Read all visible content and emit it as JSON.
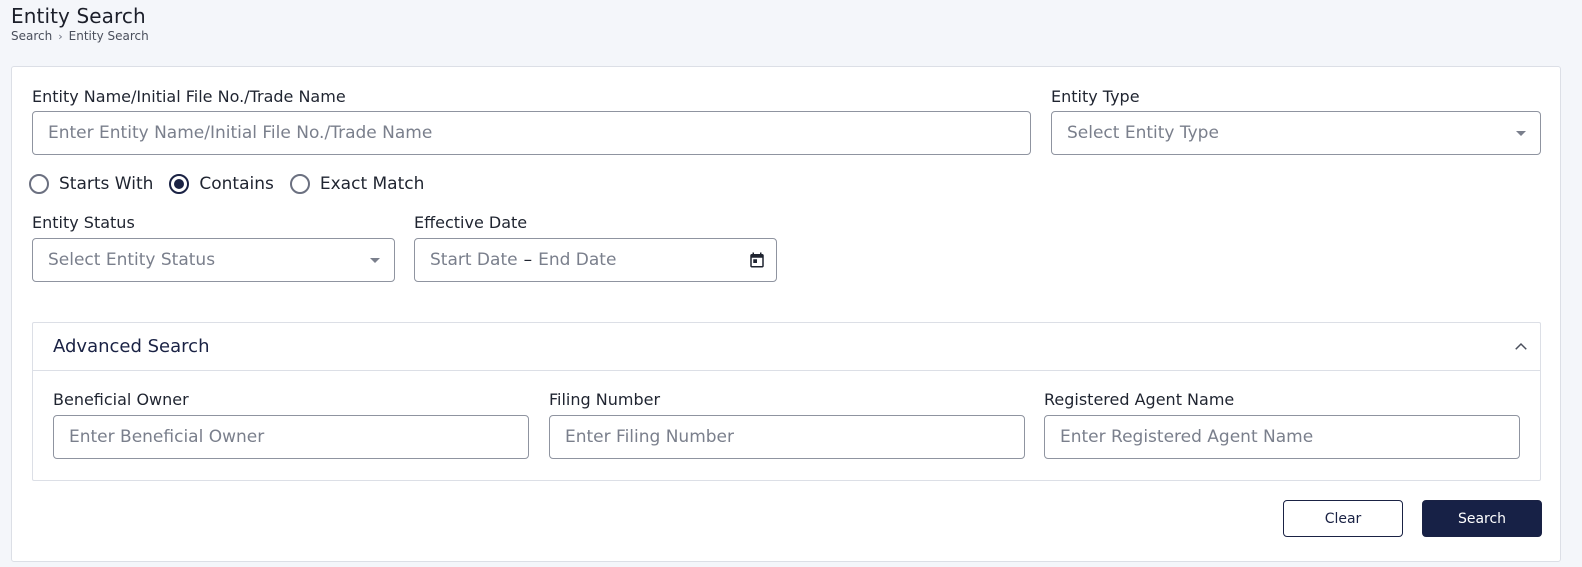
{
  "header": {
    "title": "Entity Search",
    "breadcrumb": [
      "Search",
      "Entity Search"
    ]
  },
  "form": {
    "entity_name": {
      "label": "Entity Name/Initial File No./Trade Name",
      "placeholder": "Enter Entity Name/Initial File No./Trade Name",
      "value": ""
    },
    "entity_type": {
      "label": "Entity Type",
      "placeholder": "Select Entity Type"
    },
    "match_options": [
      {
        "label": "Starts With",
        "checked": false
      },
      {
        "label": "Contains",
        "checked": true
      },
      {
        "label": "Exact Match",
        "checked": false
      }
    ],
    "entity_status": {
      "label": "Entity Status",
      "placeholder": "Select Entity Status"
    },
    "effective_date": {
      "label": "Effective Date",
      "start_placeholder": "Start Date",
      "separator": "–",
      "end_placeholder": "End Date"
    }
  },
  "advanced": {
    "title": "Advanced Search",
    "expanded": true,
    "beneficial_owner": {
      "label": "Beneficial Owner",
      "placeholder": "Enter Beneficial Owner",
      "value": ""
    },
    "filing_number": {
      "label": "Filing Number",
      "placeholder": "Enter Filing Number",
      "value": ""
    },
    "registered_agent": {
      "label": "Registered Agent Name",
      "placeholder": "Enter Registered Agent Name",
      "value": ""
    }
  },
  "actions": {
    "clear_label": "Clear",
    "search_label": "Search"
  },
  "colors": {
    "primary": "#172146",
    "border": "#8f94a0",
    "background": "#f4f6fa"
  }
}
